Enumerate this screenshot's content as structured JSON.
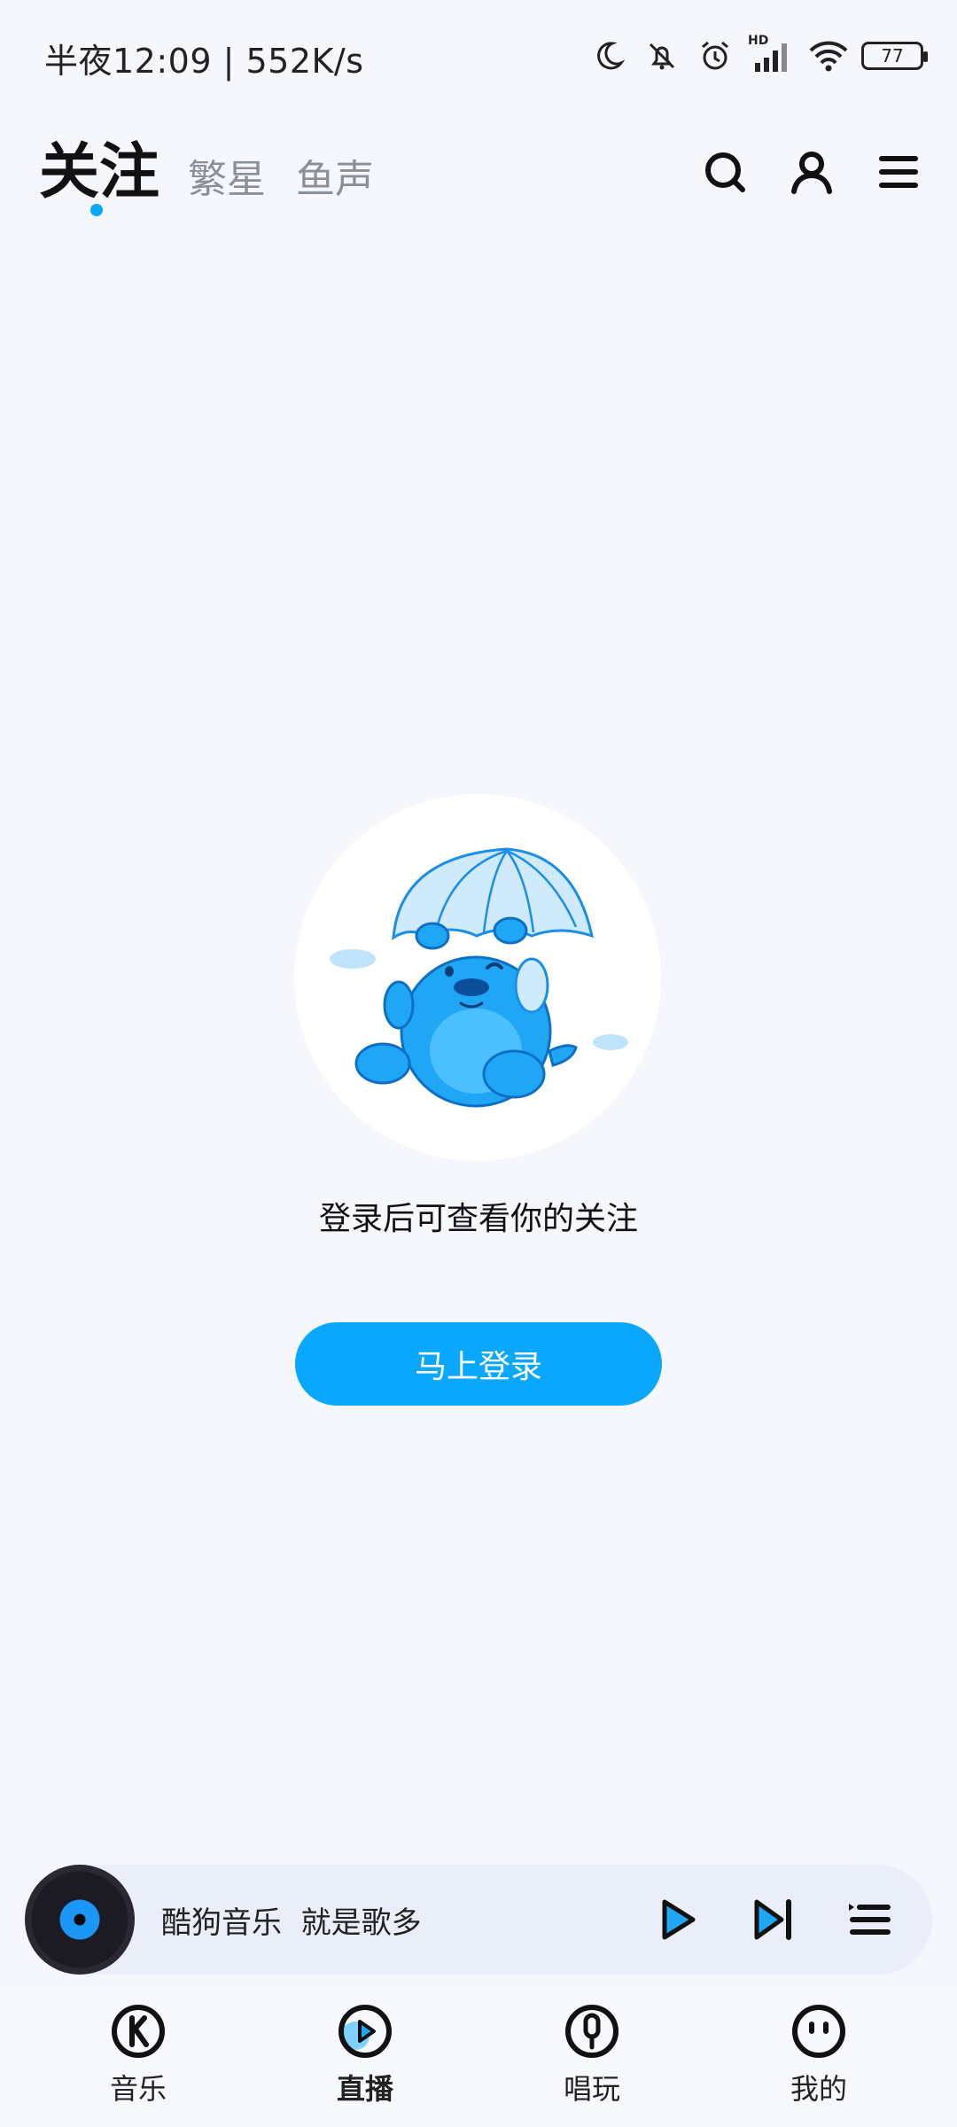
{
  "status_bar": {
    "time": "半夜12:09 | 552K/s",
    "battery": "77",
    "network_badge": "HD"
  },
  "header": {
    "tabs": [
      {
        "label": "关注",
        "active": true
      },
      {
        "label": "繁星",
        "active": false
      },
      {
        "label": "鱼声",
        "active": false
      }
    ],
    "icons": [
      "search-icon",
      "profile-icon",
      "menu-icon"
    ]
  },
  "empty_state": {
    "message": "登录后可查看你的关注",
    "button_label": "马上登录",
    "illustration": "mascot-parachute"
  },
  "player": {
    "title": "酷狗音乐  就是歌多",
    "controls": [
      "play-icon",
      "next-icon",
      "playlist-icon"
    ]
  },
  "bottom_nav": {
    "items": [
      {
        "label": "音乐",
        "icon": "kugou-k-icon",
        "active": false
      },
      {
        "label": "直播",
        "icon": "live-icon",
        "active": true
      },
      {
        "label": "唱玩",
        "icon": "sing-icon",
        "active": false
      },
      {
        "label": "我的",
        "icon": "smiley-icon",
        "active": false
      }
    ]
  },
  "colors": {
    "accent": "#0aa7ff",
    "background": "#f5f7fc",
    "player_bg": "#eaeef8"
  }
}
